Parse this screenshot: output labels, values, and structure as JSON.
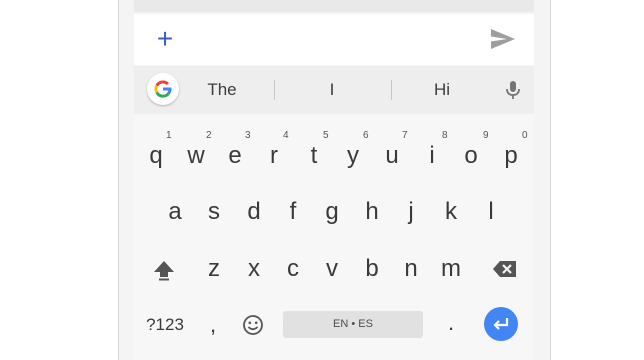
{
  "colors": {
    "accent": "#4285f4",
    "plus": "#3b5fc0",
    "key_text": "#3a3a3a",
    "suggestion_bar": "#eeeeee",
    "keyboard_bg": "#f7f7f7"
  },
  "compose": {
    "plus_label": "+",
    "send_icon": "send-icon"
  },
  "suggestions": {
    "logo_icon": "google-g-icon",
    "items": [
      "The",
      "I",
      "Hi"
    ],
    "mic_icon": "mic-icon"
  },
  "keyboard": {
    "row1": [
      {
        "label": "q",
        "hint": "1"
      },
      {
        "label": "w",
        "hint": "2"
      },
      {
        "label": "e",
        "hint": "3"
      },
      {
        "label": "r",
        "hint": "4"
      },
      {
        "label": "t",
        "hint": "5"
      },
      {
        "label": "y",
        "hint": "6"
      },
      {
        "label": "u",
        "hint": "7"
      },
      {
        "label": "i",
        "hint": "8"
      },
      {
        "label": "o",
        "hint": "9"
      },
      {
        "label": "p",
        "hint": "0"
      }
    ],
    "row2": [
      "a",
      "s",
      "d",
      "f",
      "g",
      "h",
      "j",
      "k",
      "l"
    ],
    "row3": [
      "z",
      "x",
      "c",
      "v",
      "b",
      "n",
      "m"
    ],
    "bottom": {
      "symbols": "?123",
      "comma": ",",
      "emoji_icon": "emoji-icon",
      "space": "EN • ES",
      "period": ".",
      "enter_icon": "enter-icon"
    },
    "shift_icon": "shift-icon",
    "backspace_icon": "backspace-icon"
  }
}
